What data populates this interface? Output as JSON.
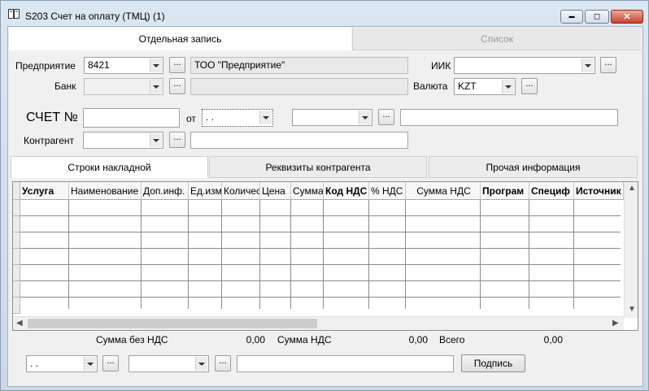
{
  "window": {
    "title": "S203 Счет на оплату (ТМЦ) (1)",
    "controls": {
      "minimize": "▬",
      "maximize": "◻",
      "close": "✕"
    }
  },
  "main_tabs": [
    {
      "label": "Отдельная запись",
      "active": true
    },
    {
      "label": "Список",
      "active": false
    }
  ],
  "form": {
    "enterprise_label": "Предприятие",
    "enterprise_code": "8421",
    "enterprise_name": "ТОО \"Предприятие\"",
    "bank_label": "Банк",
    "bank_code": "",
    "bank_name": "",
    "iik_label": "ИИК",
    "iik_value": "",
    "currency_label": "Валюта",
    "currency_value": "KZT",
    "invoice_label": "СЧЕТ №",
    "invoice_number": "",
    "date_label": "от",
    "date_value": " .  .",
    "extra_select": "",
    "extra_text": "",
    "contractor_label": "Контрагент",
    "contractor_code": "",
    "contractor_name": ""
  },
  "inner_tabs": [
    {
      "label": "Строки накладной",
      "active": true
    },
    {
      "label": "Реквизиты контрагента",
      "active": false
    },
    {
      "label": "Прочая информация",
      "active": false
    }
  ],
  "grid": {
    "columns": [
      {
        "label": "Услуга",
        "bold": true
      },
      {
        "label": "Наименование",
        "bold": false
      },
      {
        "label": "Доп.инф.",
        "bold": false
      },
      {
        "label": "Ед.изм",
        "bold": false
      },
      {
        "label": "Количес",
        "bold": false
      },
      {
        "label": "Цена",
        "bold": false
      },
      {
        "label": "Сумма",
        "bold": false
      },
      {
        "label": "Код НДС",
        "bold": true
      },
      {
        "label": "% НДС",
        "bold": false
      },
      {
        "label": "Сумма НДС",
        "bold": false
      },
      {
        "label": "Програм",
        "bold": true
      },
      {
        "label": "Специф",
        "bold": true
      },
      {
        "label": "Источник",
        "bold": true
      }
    ],
    "scroll": {
      "up": "▲",
      "down": "▼",
      "left": "◀",
      "right": "▶"
    }
  },
  "totals": {
    "sum_without_vat_label": "Сумма без НДС",
    "sum_without_vat": "0,00",
    "vat_sum_label": "Сумма НДС",
    "vat_sum": "0,00",
    "total_label": "Всего",
    "total": "0,00"
  },
  "footer": {
    "date_value": " .  .",
    "select_value": "",
    "text_value": "",
    "sign_button": "Подпись"
  },
  "ellipsis": "..."
}
